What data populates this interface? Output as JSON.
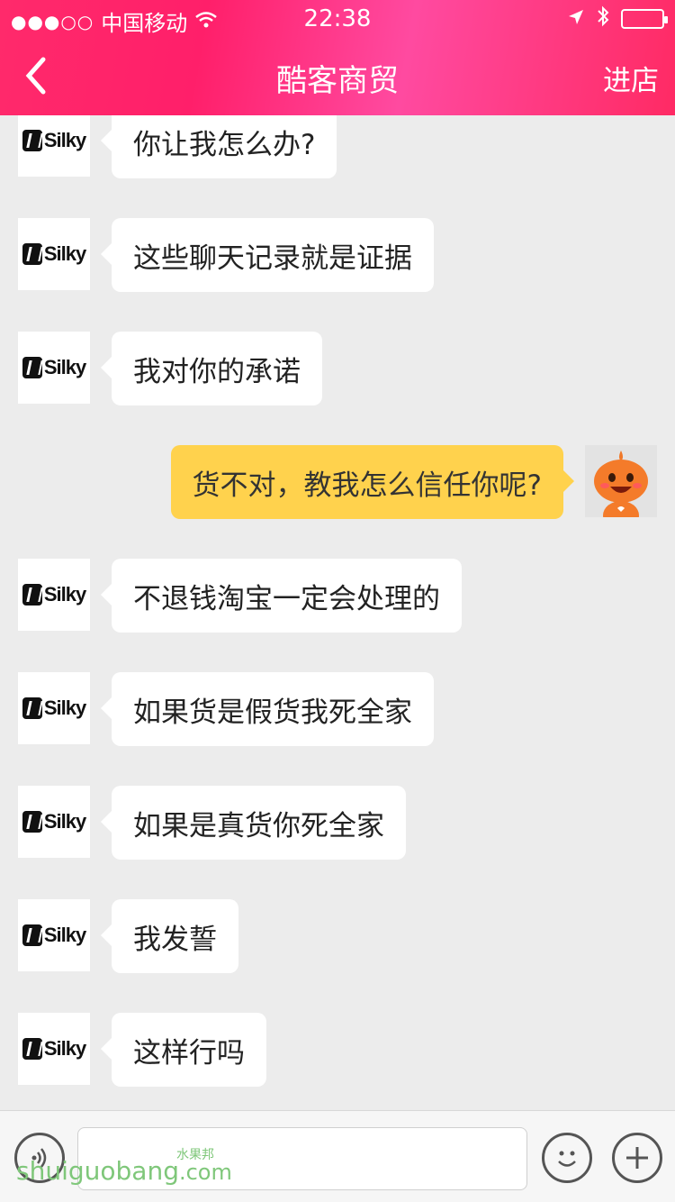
{
  "status_bar": {
    "signal": "●●●○○",
    "carrier": "中国移动",
    "time": "22:38"
  },
  "nav": {
    "title": "酷客商贸",
    "right_action": "进店"
  },
  "avatar": {
    "brand_text": "Silky"
  },
  "messages": [
    {
      "side": "left",
      "text": "你让我怎么办?"
    },
    {
      "side": "left",
      "text": "这些聊天记录就是证据"
    },
    {
      "side": "left",
      "text": "我对你的承诺"
    },
    {
      "side": "right",
      "text": "货不对，教我怎么信任你呢?"
    },
    {
      "side": "left",
      "text": "不退钱淘宝一定会处理的"
    },
    {
      "side": "left",
      "text": "如果货是假货我死全家"
    },
    {
      "side": "left",
      "text": "如果是真货你死全家"
    },
    {
      "side": "left",
      "text": "我发誓"
    },
    {
      "side": "left",
      "text": "这样行吗"
    }
  ],
  "watermark": {
    "text": "shuiguobang",
    "small": "水果邦",
    "suffix": ".com"
  },
  "colors": {
    "header": "#ff2a6b",
    "bubble_self": "#ffd24d",
    "bubble_other": "#ffffff",
    "background": "#ececec"
  },
  "icons": [
    "back-chevron-icon",
    "wifi-icon",
    "location-arrow-icon",
    "bluetooth-icon",
    "battery-icon",
    "voice-icon",
    "emoji-icon",
    "plus-icon"
  ]
}
